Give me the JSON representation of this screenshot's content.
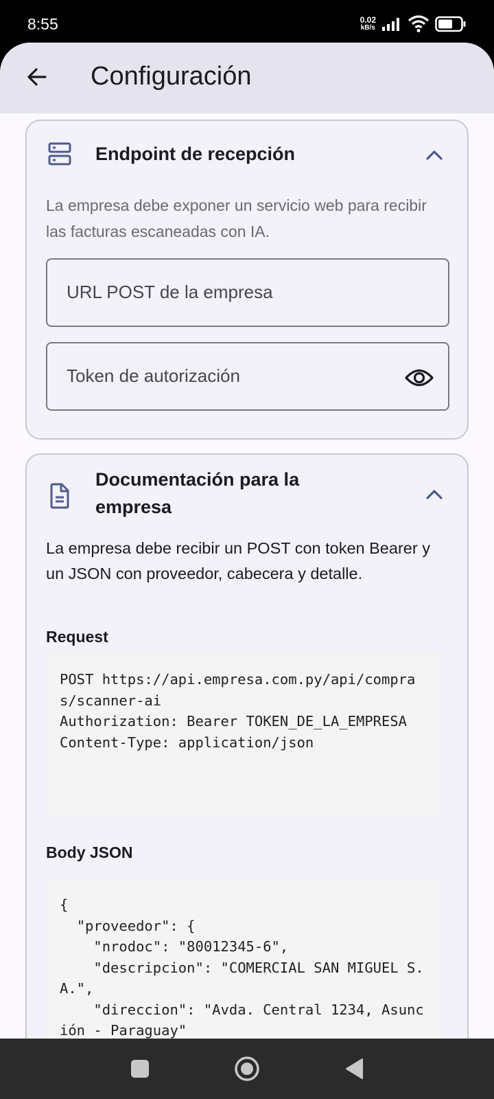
{
  "status_bar": {
    "time": "8:55",
    "net_speed_value": "0.02",
    "net_speed_unit": "kB/s",
    "icons": [
      "signal-icon",
      "wifi-icon",
      "battery-icon"
    ]
  },
  "app_bar": {
    "title": "Configuración",
    "back_icon": "arrow-left-icon"
  },
  "endpoint_card": {
    "icon": "server-icon",
    "title": "Endpoint de recepción",
    "description": "La empresa debe exponer un servicio web para recibir las facturas escaneadas con IA.",
    "url_field": {
      "placeholder": "URL POST de la empresa",
      "value": ""
    },
    "token_field": {
      "placeholder": "Token de autorización",
      "value": ""
    }
  },
  "docs_card": {
    "icon": "document-icon",
    "title": "Documentación para la empresa",
    "description": "La empresa debe recibir un POST con token Bearer y un JSON con proveedor, cabecera y detalle.",
    "request_label": "Request",
    "request_code": "POST https://api.empresa.com.py/api/compras/scanner-ai\nAuthorization: Bearer TOKEN_DE_LA_EMPRESA\nContent-Type: application/json",
    "body_label": "Body JSON",
    "body_code": "{\n  \"proveedor\": {\n    \"nrodoc\": \"80012345-6\",\n    \"descripcion\": \"COMERCIAL SAN MIGUEL S.A.\",\n    \"direccion\": \"Avda. Central 1234, Asunción - Paraguay\""
  },
  "colors": {
    "accent": "#4f5a8c",
    "surface": "#fbf8fe",
    "card": "#f3f1f9",
    "app_bar": "#e5e4ee"
  }
}
